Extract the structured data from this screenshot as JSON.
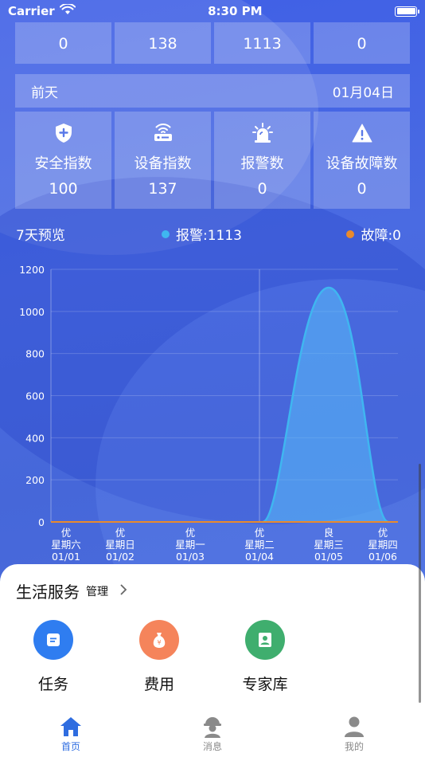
{
  "status_bar": {
    "carrier": "Carrier",
    "time": "8:30 PM"
  },
  "top_row": {
    "values": [
      "0",
      "138",
      "1113",
      "0"
    ]
  },
  "day": {
    "label": "前天",
    "date": "01月04日"
  },
  "stats": [
    {
      "label": "安全指数",
      "value": "100",
      "icon": "shield-plus-icon"
    },
    {
      "label": "设备指数",
      "value": "137",
      "icon": "router-icon"
    },
    {
      "label": "报警数",
      "value": "0",
      "icon": "siren-icon"
    },
    {
      "label": "设备故障数",
      "value": "0",
      "icon": "warning-triangle-icon"
    }
  ],
  "preview": {
    "title": "7天预览",
    "alarm_label": "报警:1113",
    "fault_label": "故障:0",
    "alarm_color": "#3fb6f0",
    "fault_color": "#e98a2d"
  },
  "chart_data": {
    "type": "area",
    "y_ticks": [
      "1200",
      "1000",
      "800",
      "600",
      "400",
      "200",
      "0"
    ],
    "ylim": [
      0,
      1200
    ],
    "categories": [
      {
        "grade": "优",
        "weekday": "星期六",
        "date": "01/01"
      },
      {
        "grade": "优",
        "weekday": "星期日",
        "date": "01/02"
      },
      {
        "grade": "优",
        "weekday": "星期一",
        "date": "01/03"
      },
      {
        "grade": "优",
        "weekday": "星期二",
        "date": "01/04"
      },
      {
        "grade": "良",
        "weekday": "星期三",
        "date": "01/05"
      },
      {
        "grade": "优",
        "weekday": "星期四",
        "date": "01/06"
      }
    ],
    "series": [
      {
        "name": "报警",
        "values": [
          0,
          0,
          0,
          0,
          1113,
          0
        ],
        "color": "#3fb6f0"
      },
      {
        "name": "故障",
        "values": [
          0,
          0,
          0,
          0,
          0,
          0
        ],
        "color": "#e98a2d"
      }
    ],
    "highlight_category": "01/04"
  },
  "services": {
    "title": "生活服务",
    "manage": "管理",
    "items": [
      {
        "label": "任务",
        "color": "#2f7df0",
        "icon": "task-icon"
      },
      {
        "label": "费用",
        "color": "#f5845b",
        "icon": "money-bag-icon"
      },
      {
        "label": "专家库",
        "color": "#3fae6e",
        "icon": "expert-icon"
      }
    ]
  },
  "tabs": [
    {
      "label": "首页",
      "icon": "home-icon",
      "active": true
    },
    {
      "label": "消息",
      "icon": "worker-icon",
      "active": false
    },
    {
      "label": "我的",
      "icon": "profile-icon",
      "active": false
    }
  ]
}
